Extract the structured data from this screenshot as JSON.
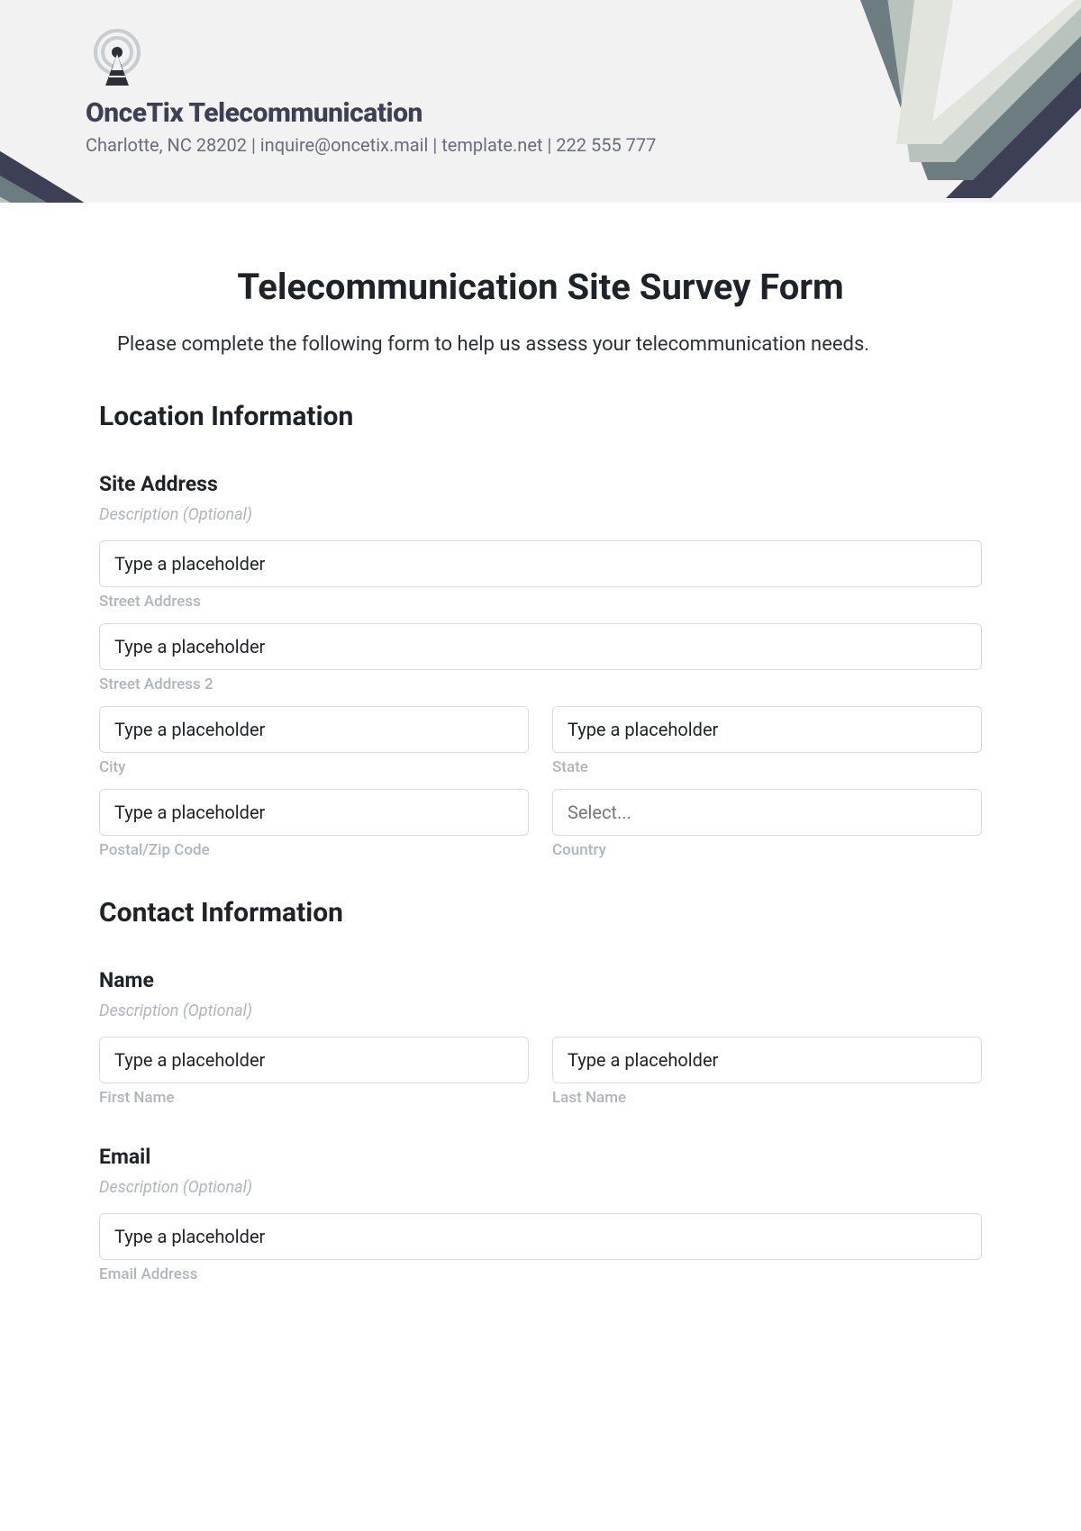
{
  "header": {
    "company_name": "OnceTix Telecommunication",
    "company_info": "Charlotte, NC 28202 | inquire@oncetix.mail | template.net | 222 555 777"
  },
  "form": {
    "title": "Telecommunication Site Survey Form",
    "intro": "Please complete the following form to help us assess your telecommunication needs."
  },
  "location": {
    "heading": "Location Information",
    "site_address": {
      "label": "Site Address",
      "description": "Description (Optional)",
      "street1": {
        "placeholder": "Type a placeholder",
        "sublabel": "Street Address"
      },
      "street2": {
        "placeholder": "Type a placeholder",
        "sublabel": "Street Address 2"
      },
      "city": {
        "placeholder": "Type a placeholder",
        "sublabel": "City"
      },
      "state": {
        "placeholder": "Type a placeholder",
        "sublabel": "State"
      },
      "postal": {
        "placeholder": "Type a placeholder",
        "sublabel": "Postal/Zip Code"
      },
      "country": {
        "placeholder": "Select...",
        "sublabel": "Country"
      }
    }
  },
  "contact": {
    "heading": "Contact Information",
    "name": {
      "label": "Name",
      "description": "Description (Optional)",
      "first": {
        "placeholder": "Type a placeholder",
        "sublabel": "First Name"
      },
      "last": {
        "placeholder": "Type a placeholder",
        "sublabel": "Last Name"
      }
    },
    "email": {
      "label": "Email",
      "description": "Description (Optional)",
      "field": {
        "placeholder": "Type a placeholder",
        "sublabel": "Email Address"
      }
    }
  }
}
